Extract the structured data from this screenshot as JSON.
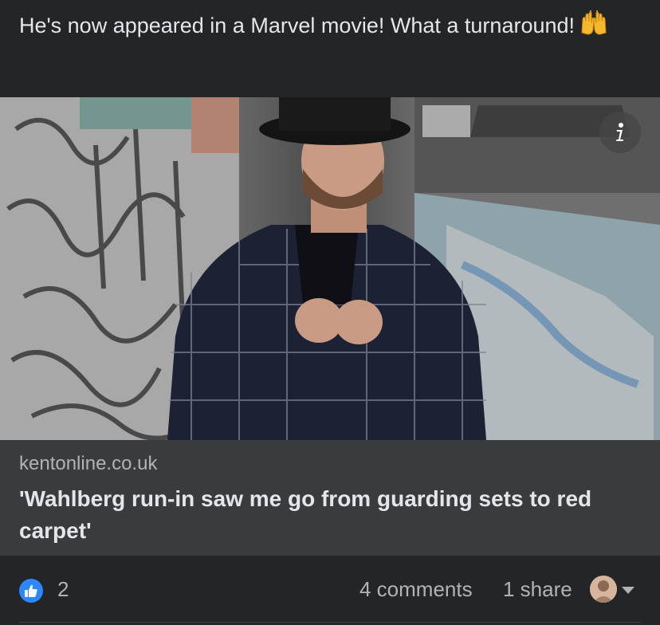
{
  "post": {
    "text": "He's now appeared in a Marvel movie! What a turnaround!",
    "emoji": "raising-hands-emoji"
  },
  "link_preview": {
    "image": "man-in-hat-and-plaid-suit-graffiti-tunnel",
    "info_icon": "info-icon",
    "domain": "kentonline.co.uk",
    "title": "'Wahlberg run-in saw me go from guarding sets to red carpet'"
  },
  "footer": {
    "like_icon": "thumbs-up-icon",
    "like_count": "2",
    "comments": "4 comments",
    "shares": "1 share",
    "reaction_avatar": "avatar",
    "dropdown_icon": "chevron-down-icon"
  },
  "colors": {
    "background": "#242526",
    "card": "#3a3b3c",
    "text": "#e4e6eb",
    "muted": "#b0b3b8",
    "accent": "#2d88ff"
  }
}
